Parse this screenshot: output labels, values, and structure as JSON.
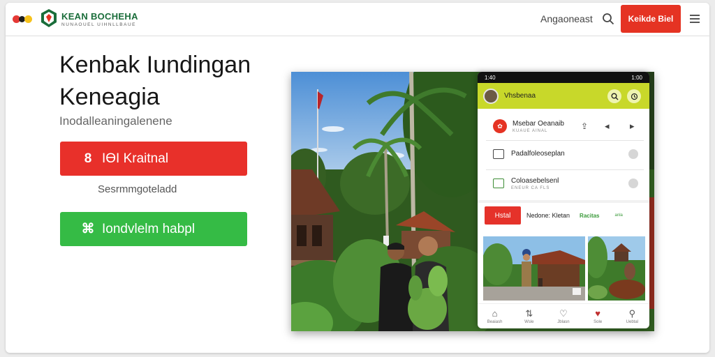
{
  "header": {
    "brand_name": "KEAN BOCHEHA",
    "brand_tagline": "NUNAOUEL UIHNLLBAUE",
    "nav_link": "Angaoneast",
    "cta_label": "Keikde Biel",
    "icons": [
      "dots-logo",
      "brand-logo",
      "search-icon",
      "menu-icon"
    ]
  },
  "hero": {
    "title": "Kenbak Iundingan Keneagia",
    "subtitle": "Inodalleaningalenene",
    "primary_button": {
      "icon": "8",
      "label": "IӨI Kraitnal"
    },
    "hint": "Sesrmmgoteladd",
    "secondary_button": {
      "icon": "⌘",
      "label": "Iondvlelm habpl"
    }
  },
  "phone": {
    "status": {
      "time": "1:40",
      "battery": "1:00"
    },
    "app_bar": {
      "title": "Vhsbenaa"
    },
    "rows": [
      {
        "title": "Msebar Oeanaib",
        "subtitle": "KUAUE AINAL"
      },
      {
        "title": "Padalfoleoseplan",
        "subtitle": ""
      },
      {
        "title": "Coloasebelsenl",
        "subtitle": "ENEUR CA FLS"
      }
    ],
    "tabs": {
      "active": "Hstal",
      "second": "Nedone: Kletan",
      "third": "Racitas",
      "fourth": "anla"
    },
    "bottom_nav": [
      "Beaiash",
      "Wsle",
      "Jblasn",
      "Sole",
      "Uebtal"
    ]
  },
  "colors": {
    "brand_red": "#e8302a",
    "brand_green": "#35bb45",
    "app_bar_lime": "#c8d82a",
    "logo_green": "#1a6d3a"
  }
}
